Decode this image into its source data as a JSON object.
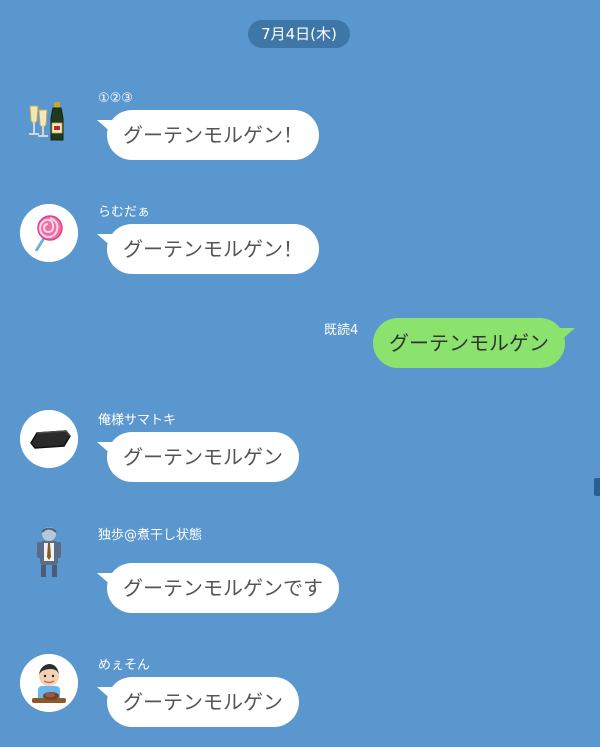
{
  "date_separator": "7月4日(木)",
  "messages": [
    {
      "sender": "①②③",
      "text": "グーテンモルゲン！",
      "avatar": "champagne-icon"
    },
    {
      "sender": "らむだぁ",
      "text": "グーテンモルゲン！",
      "avatar": "lollipop-icon"
    },
    {
      "sender": "",
      "text": "グーテンモルゲン",
      "read_receipt": "既読4",
      "own": true
    },
    {
      "sender": "俺様サマトキ",
      "text": "グーテンモルゲン",
      "avatar": "black-object-icon"
    },
    {
      "sender": "独歩@煮干し状態",
      "text": "グーテンモルゲンです",
      "avatar": "tired-man-icon"
    },
    {
      "sender": "めぇそん",
      "text": "グーテンモルゲン",
      "avatar": "person-eating-icon"
    }
  ],
  "colors": {
    "background": "#5b97cf",
    "date_pill": "#3f76a8",
    "incoming_bubble": "#ffffff",
    "own_bubble": "#8be36e"
  }
}
